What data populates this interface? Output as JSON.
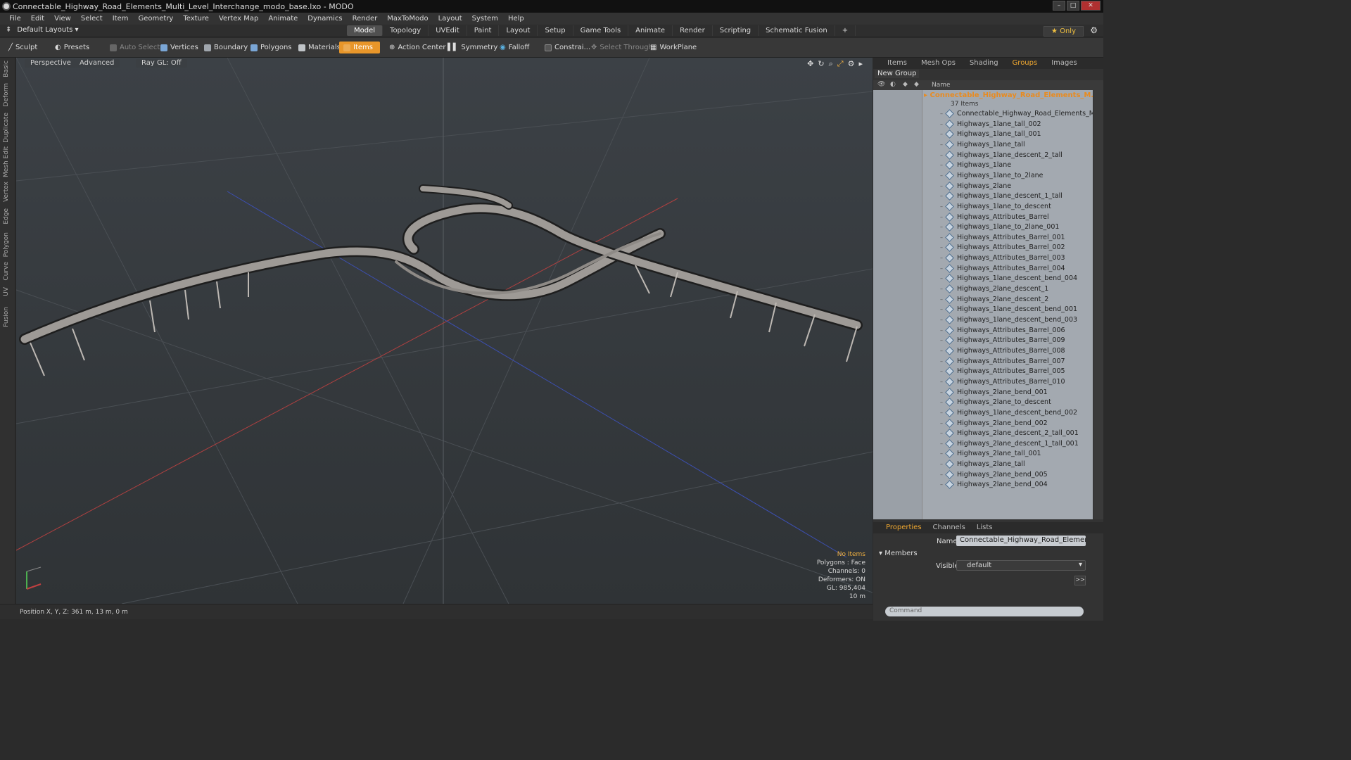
{
  "window": {
    "title": "Connectable_Highway_Road_Elements_Multi_Level_Interchange_modo_base.lxo - MODO"
  },
  "menu": [
    "File",
    "Edit",
    "View",
    "Select",
    "Item",
    "Geometry",
    "Texture",
    "Vertex Map",
    "Animate",
    "Dynamics",
    "Render",
    "MaxToModo",
    "Layout",
    "System",
    "Help"
  ],
  "layouts": {
    "label": "Default Layouts",
    "tabs": [
      "Model",
      "Topology",
      "UVEdit",
      "Paint",
      "Layout",
      "Setup",
      "Game Tools",
      "Animate",
      "Render",
      "Scripting",
      "Schematic Fusion"
    ],
    "active": "Model",
    "only": "Only"
  },
  "toolbar": {
    "sculpt": "Sculpt",
    "presets": "Presets",
    "auto_select": "Auto Select",
    "vertices": "Vertices",
    "boundary": "Boundary",
    "polygons": "Polygons",
    "materials": "Materials",
    "items": "Items",
    "action_center": "Action Center",
    "symmetry": "Symmetry",
    "falloff": "Falloff",
    "constraints": "Constrai...",
    "select_through": "Select Through",
    "workplane": "WorkPlane"
  },
  "left_strip": [
    "Basic",
    "Deform",
    "Duplicate",
    "Mesh Edit",
    "Vertex",
    "Edge",
    "Polygon",
    "Curve",
    "UV",
    "Fusion"
  ],
  "viewport": {
    "perspective": "Perspective",
    "advanced": "Advanced",
    "raygl": "Ray GL: Off",
    "stats": {
      "no_items": "No Items",
      "polygons": "Polygons : Face",
      "channels": "Channels: 0",
      "deformers": "Deformers: ON",
      "gl": "GL: 985,404",
      "scale": "10 m"
    }
  },
  "status": {
    "position": "Position X, Y, Z:   361 m, 13 m, 0 m"
  },
  "right_panel": {
    "tabs": [
      "Items",
      "Mesh Ops",
      "Shading",
      "Groups",
      "Images"
    ],
    "active_tab": "Groups",
    "new_group": "New Group",
    "column_name": "Name",
    "group_name": "Connectable_Highway_Road_Elements_M...",
    "group_count": "37 Items",
    "items": [
      "Connectable_Highway_Road_Elements_Multi_L...",
      "Highways_1lane_tall_002",
      "Highways_1lane_tall_001",
      "Highways_1lane_tall",
      "Highways_1lane_descent_2_tall",
      "Highways_1lane",
      "Highways_1lane_to_2lane",
      "Highways_2lane",
      "Highways_1lane_descent_1_tall",
      "Highways_1lane_to_descent",
      "Highways_Attributes_Barrel",
      "Highways_1lane_to_2lane_001",
      "Highways_Attributes_Barrel_001",
      "Highways_Attributes_Barrel_002",
      "Highways_Attributes_Barrel_003",
      "Highways_Attributes_Barrel_004",
      "Highways_1lane_descent_bend_004",
      "Highways_2lane_descent_1",
      "Highways_2lane_descent_2",
      "Highways_1lane_descent_bend_001",
      "Highways_1lane_descent_bend_003",
      "Highways_Attributes_Barrel_006",
      "Highways_Attributes_Barrel_009",
      "Highways_Attributes_Barrel_008",
      "Highways_Attributes_Barrel_007",
      "Highways_Attributes_Barrel_005",
      "Highways_Attributes_Barrel_010",
      "Highways_2lane_bend_001",
      "Highways_2lane_to_descent",
      "Highways_1lane_descent_bend_002",
      "Highways_2lane_bend_002",
      "Highways_2lane_descent_2_tall_001",
      "Highways_2lane_descent_1_tall_001",
      "Highways_2lane_tall_001",
      "Highways_2lane_tall",
      "Highways_2lane_bend_005",
      "Highways_2lane_bend_004"
    ]
  },
  "properties": {
    "tabs": [
      "Properties",
      "Channels",
      "Lists"
    ],
    "name_label": "Name",
    "name_value": "Connectable_Highway_Road_Elements_Multi",
    "members": "Members",
    "visible_label": "Visible",
    "visible_value": "default",
    "command_placeholder": "Command"
  }
}
